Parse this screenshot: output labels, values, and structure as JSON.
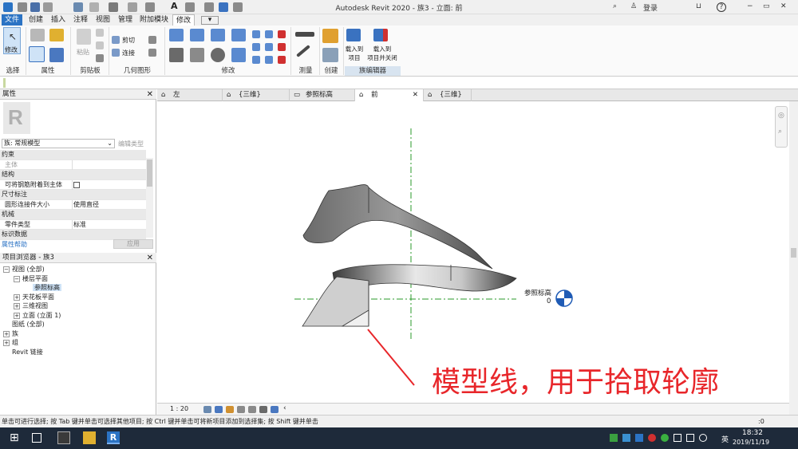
{
  "title_bar": {
    "app_title": "Autodesk Revit 2020 - 族3 - 立面: 前",
    "sign_in": "登录",
    "help": "?"
  },
  "ribbon_tabs": [
    "文件",
    "创建",
    "插入",
    "注释",
    "视图",
    "管理",
    "附加模块",
    "修改"
  ],
  "ribbon": {
    "modify_label": "修改",
    "panels": {
      "select": "选择",
      "properties": "属性",
      "clipboard": "剪贴板",
      "geometry": "几何图形",
      "modify": "修改",
      "measure": "测量",
      "create": "创建",
      "family_editor": "族编辑器"
    },
    "paste": "粘贴",
    "cut": "剪切",
    "join": "连接",
    "load_into_project": "载入到\n项目",
    "load_into_project_close": "载入到\n项目并关闭"
  },
  "properties_palette": {
    "title": "属性",
    "type_selector": "族: 常规模型",
    "edit_type": "编辑类型",
    "rows": [
      {
        "category": "约束"
      },
      {
        "name": "主体",
        "value": "",
        "disabled": true
      },
      {
        "category": "结构"
      },
      {
        "name": "可将钢筋附着到主体",
        "value": "",
        "checkbox": true
      },
      {
        "category": "尺寸标注"
      },
      {
        "name": "圆形连接件大小",
        "value": "使用直径"
      },
      {
        "category": "机械"
      },
      {
        "name": "零件类型",
        "value": "标准"
      },
      {
        "category": "标识数据"
      }
    ],
    "help_link": "属性帮助",
    "apply": "应用"
  },
  "project_browser": {
    "title": "项目浏览器 - 族3",
    "items": [
      {
        "label": "视图 (全部)",
        "level": 0,
        "toggle": "−"
      },
      {
        "label": "楼层平面",
        "level": 1,
        "toggle": "−"
      },
      {
        "label": "参照标高",
        "level": 2,
        "toggle": "",
        "selected": true
      },
      {
        "label": "天花板平面",
        "level": 1,
        "toggle": "+"
      },
      {
        "label": "三维视图",
        "level": 1,
        "toggle": "+"
      },
      {
        "label": "立面 (立面 1)",
        "level": 1,
        "toggle": "+"
      },
      {
        "label": "图纸 (全部)",
        "level": 0,
        "toggle": ""
      },
      {
        "label": "族",
        "level": 0,
        "toggle": "+"
      },
      {
        "label": "组",
        "level": 0,
        "toggle": "+"
      },
      {
        "label": "Revit 链接",
        "level": 0,
        "toggle": ""
      }
    ]
  },
  "view_tabs": [
    {
      "label": "左",
      "active": false
    },
    {
      "label": "{三维}",
      "active": false
    },
    {
      "label": "参照标高",
      "active": false
    },
    {
      "label": "前",
      "active": true
    },
    {
      "label": "{三维}",
      "active": false
    }
  ],
  "canvas": {
    "level_name": "参照标高",
    "level_value": "0",
    "annotation": "模型线，用于拾取轮廓"
  },
  "view_control": {
    "scale": "1 : 20"
  },
  "status_bar": {
    "text": "单击可进行选择; 按 Tab 键并单击可选择其他项目; 按 Ctrl 键并单击可将新项目添加到选择集; 按 Shift 键并单击",
    "right_value": ":0"
  },
  "taskbar": {
    "ime": "英",
    "time": "18:32",
    "date": "2019/11/19"
  },
  "colors": {
    "file_tab": "#2b73c4",
    "taskbar": "#1e2a3a",
    "annotation_red": "#e8262a",
    "ref_plane_green": "#2a9a2a"
  }
}
